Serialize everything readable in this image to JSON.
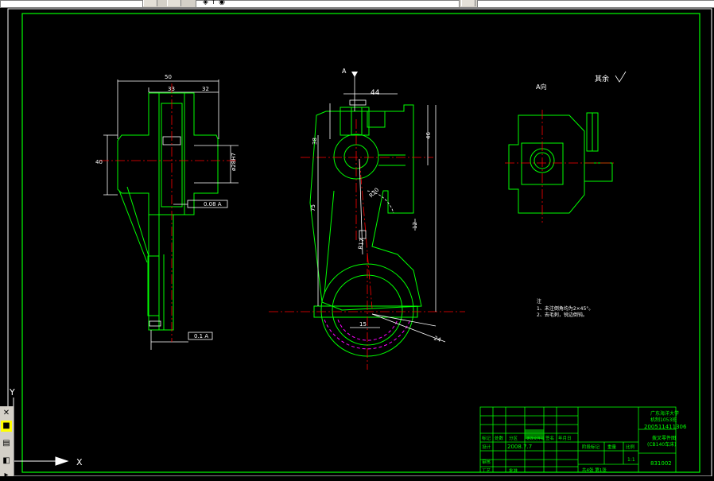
{
  "toolbar": {
    "layer_value": "",
    "linetype_value": "",
    "lineweight_value": ""
  },
  "drawing": {
    "section_label": "A",
    "view_label": "A向",
    "roughness_note": "其余",
    "dims": {
      "w50": "50",
      "w33": "33",
      "w32": "32",
      "h40": "40",
      "phi_b": "ø28H7",
      "d44": "44",
      "d38": "38",
      "d46": "46",
      "d75": "75",
      "d12": "12",
      "d15": "15",
      "r20": "R20",
      "r17": "R17",
      "d24": "24",
      "tol_flat": "0.08 A",
      "tol_perp": "0.1 A"
    },
    "notes": {
      "title": "注",
      "line1": "1、未注倒角均为2×45°。",
      "line2": "2、去毛刺，锐边倒钝。"
    }
  },
  "title_block": {
    "school": "广东海洋大学",
    "class_name": "机制1053班",
    "student_id": "200511411306",
    "part_name": "拨叉零件图",
    "machine": "(CB140车床)",
    "drawing_no": "831002",
    "scale": "1:1",
    "sheets": "共4张  第1张",
    "date": "2008.7.7",
    "col_labels": [
      "标记",
      "处数",
      "分区",
      "更改文件号",
      "签名",
      "年月日"
    ],
    "row_designer": "设计",
    "row_check": "审核",
    "row_process": "工艺",
    "row_approve": "批准",
    "stage_label": "阶段标记",
    "weight_label": "重量",
    "ratio_label": "比例",
    "name_signed": "签名"
  },
  "ucs": {
    "y_label": "Y",
    "x_label": "X"
  },
  "colors": {
    "background": "#000000",
    "outline": "#00ff00",
    "white_line": "#ffffff",
    "center_line": "#ff0000",
    "hidden_line": "#ff00ff",
    "frame": "#00ff00"
  }
}
